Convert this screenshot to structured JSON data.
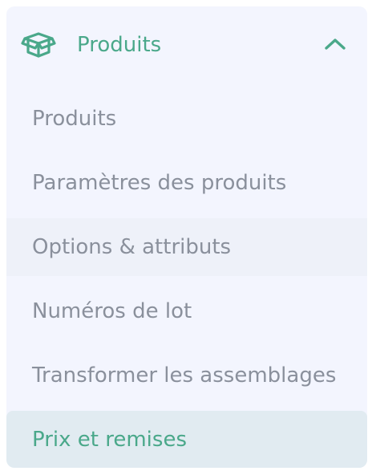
{
  "colors": {
    "accent": "#4aa88a",
    "panel_background": "#f3f5fe",
    "text_muted": "#8a909c",
    "hover_background": "#eef1f9",
    "active_background": "#e1ebf1"
  },
  "section": {
    "icon": "box-icon",
    "label": "Produits",
    "expanded": true,
    "toggle_icon": "chevron-up-icon"
  },
  "items": [
    {
      "label": "Produits",
      "state": "default"
    },
    {
      "label": "Paramètres des produits",
      "state": "default"
    },
    {
      "label": "Options & attributs",
      "state": "hover"
    },
    {
      "label": "Numéros de lot",
      "state": "default"
    },
    {
      "label": "Transformer les assemblages",
      "state": "default"
    },
    {
      "label": "Prix et remises",
      "state": "active"
    }
  ]
}
